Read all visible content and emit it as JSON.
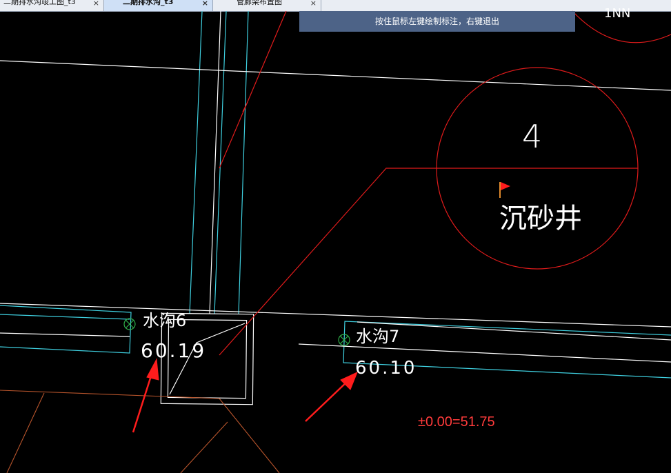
{
  "tabs": [
    {
      "label": "二期排水沟竣工图_t3",
      "active": false
    },
    {
      "label": "二期排水沟_t3",
      "active": true
    },
    {
      "label": "管廊架布置图",
      "active": false
    }
  ],
  "tab_close_glyph": "×",
  "prompt_banner": "按住鼠标左键绘制标注，右键退出",
  "drawing": {
    "top_right_fragment": "1NN",
    "circle_number": "4",
    "circle_label": "沉砂井",
    "labels": [
      {
        "name": "水沟6",
        "elevation": "60.19"
      },
      {
        "name": "水沟7",
        "elevation": "60.10"
      }
    ],
    "datum_note": "±0.00=51.75"
  },
  "colors": {
    "background": "#000000",
    "cyan_lines": "#3fd0e0",
    "white_lines": "#ffffff",
    "red_lines": "#e11b1b",
    "orange_lines": "#b9552c",
    "marker_green": "#2fb04a",
    "banner_bg": "#4d6387"
  },
  "icons": [
    "close-icon",
    "flag-icon",
    "survey-point-icon",
    "arrow-annotation-icon"
  ]
}
